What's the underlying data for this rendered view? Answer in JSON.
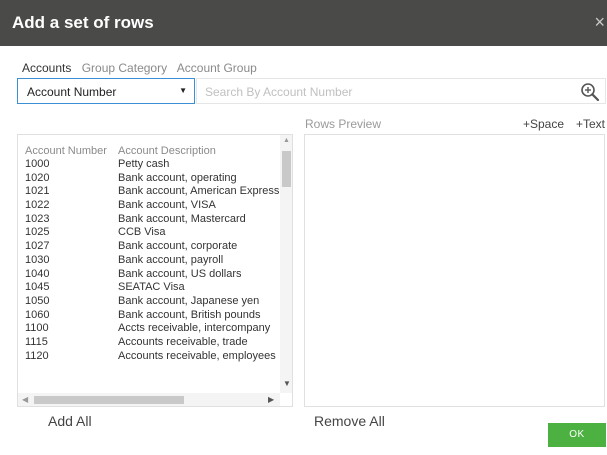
{
  "dialog": {
    "title": "Add a set of rows",
    "close_glyph": "×"
  },
  "tabs": [
    {
      "label": "Accounts"
    },
    {
      "label": "Group Category"
    },
    {
      "label": "Account Group"
    }
  ],
  "filter": {
    "selected": "Account Number",
    "caret": "▼",
    "search_placeholder": "Search By Account Number",
    "search_icon": "zoom-in-icon"
  },
  "list": {
    "columns": [
      "Account Number",
      "Account Description"
    ],
    "rows": [
      {
        "number": "1000",
        "description": "Petty cash"
      },
      {
        "number": "1020",
        "description": "Bank account, operating"
      },
      {
        "number": "1021",
        "description": "Bank account, American Express"
      },
      {
        "number": "1022",
        "description": "Bank account, VISA"
      },
      {
        "number": "1023",
        "description": "Bank account, Mastercard"
      },
      {
        "number": "1025",
        "description": "CCB Visa"
      },
      {
        "number": "1027",
        "description": "Bank account, corporate"
      },
      {
        "number": "1030",
        "description": "Bank account, payroll"
      },
      {
        "number": "1040",
        "description": "Bank account, US dollars"
      },
      {
        "number": "1045",
        "description": "SEATAC Visa"
      },
      {
        "number": "1050",
        "description": "Bank account, Japanese yen"
      },
      {
        "number": "1060",
        "description": "Bank account, British pounds"
      },
      {
        "number": "1100",
        "description": "Accts receivable, intercompany"
      },
      {
        "number": "1115",
        "description": "Accounts receivable, trade"
      },
      {
        "number": "1120",
        "description": "Accounts receivable, employees"
      }
    ]
  },
  "preview": {
    "label": "Rows Preview",
    "add_space": "+Space",
    "add_text": "+Text"
  },
  "actions": {
    "add_all": "Add All",
    "remove_all": "Remove All",
    "ok": "OK"
  },
  "colors": {
    "titlebar": "#4a4a48",
    "ok_button": "#4cb140",
    "select_border": "#3b8fd6"
  }
}
